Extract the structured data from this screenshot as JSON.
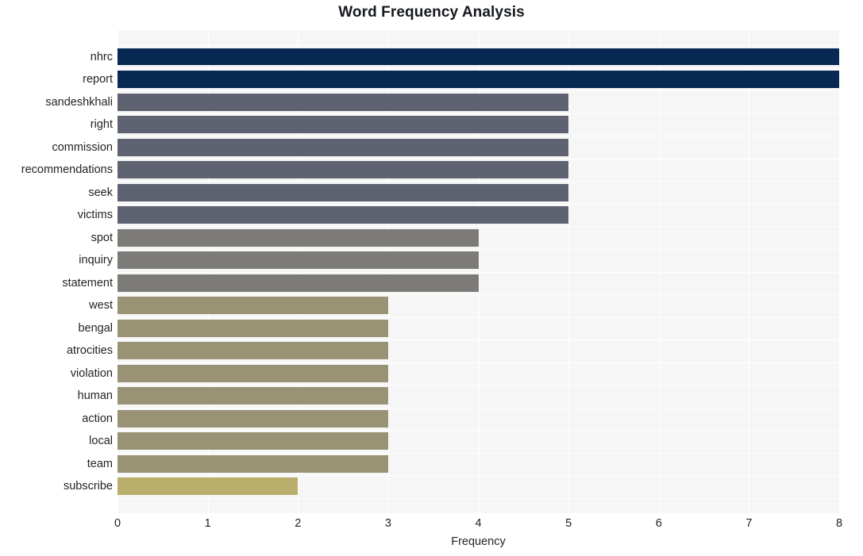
{
  "chart_data": {
    "type": "bar",
    "orientation": "horizontal",
    "title": "Word Frequency Analysis",
    "xlabel": "Frequency",
    "ylabel": "",
    "xlim": [
      0,
      8
    ],
    "xticks": [
      0,
      1,
      2,
      3,
      4,
      5,
      6,
      7,
      8
    ],
    "xtick_labels": [
      "0",
      "1",
      "2",
      "3",
      "4",
      "5",
      "6",
      "7",
      "8"
    ],
    "grid": true,
    "legend": "none",
    "categories": [
      "nhrc",
      "report",
      "sandeshkhali",
      "right",
      "commission",
      "recommendations",
      "seek",
      "victims",
      "spot",
      "inquiry",
      "statement",
      "west",
      "bengal",
      "atrocities",
      "violation",
      "human",
      "action",
      "local",
      "team",
      "subscribe"
    ],
    "values": [
      8,
      8,
      5,
      5,
      5,
      5,
      5,
      5,
      4,
      4,
      4,
      3,
      3,
      3,
      3,
      3,
      3,
      3,
      3,
      2
    ],
    "bar_colors": [
      "#072953",
      "#072953",
      "#5f6371",
      "#5f6371",
      "#5f6371",
      "#5f6371",
      "#5f6371",
      "#5f6371",
      "#7c7b77",
      "#7c7b77",
      "#7c7b77",
      "#9a9274",
      "#9a9274",
      "#9a9274",
      "#9a9274",
      "#9a9274",
      "#9a9274",
      "#9a9274",
      "#9a9274",
      "#b9ae6b"
    ]
  },
  "style": {
    "plot_background": "#f6f6f7",
    "grid_color": "#ffffff",
    "figure_background": "#ffffff",
    "text_color": "#232323",
    "title_color": "#16191d"
  }
}
